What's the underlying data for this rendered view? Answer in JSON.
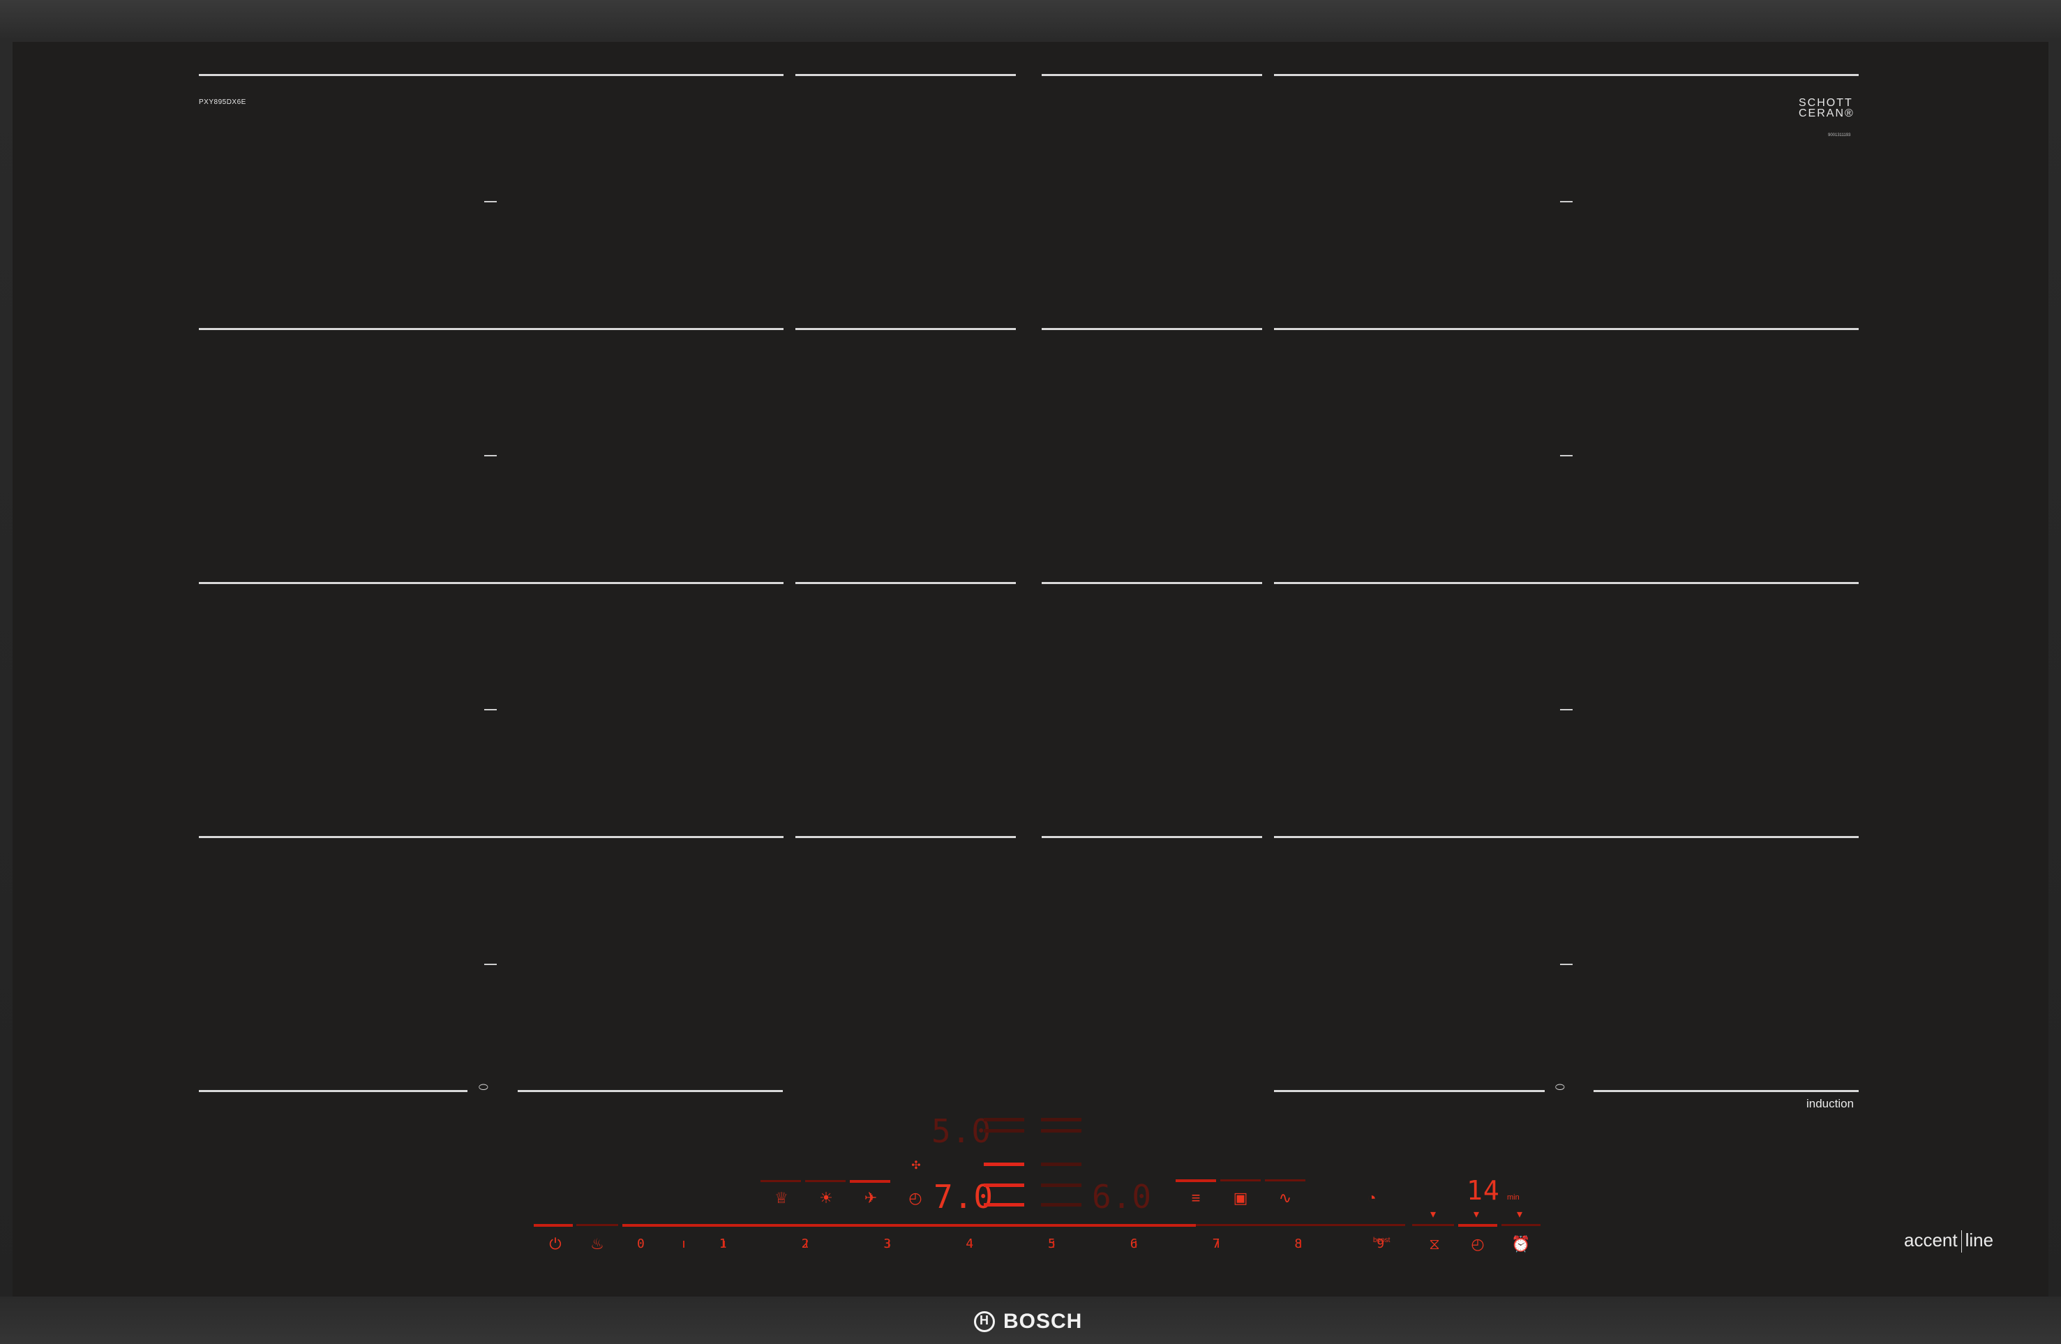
{
  "model": "PXY895DX6E",
  "brand_mark": {
    "line1": "SCHOTT",
    "line2": "CERAN®",
    "serial": "9001311193"
  },
  "induction_label": "induction",
  "series_label": {
    "left": "accent",
    "right": "line"
  },
  "brand_logo": "BOSCH",
  "zone_symbol": "⬭",
  "colors": {
    "glass": "#1f1e1d",
    "zone_lines": "#d9d9d9",
    "control_red": "#e02b1a"
  },
  "controls": {
    "power_icon": "power-icon",
    "child_lock_icon": "child-lock-icon",
    "slider_numbers": [
      "0",
      "1",
      "2",
      "3",
      "4",
      "5",
      "6",
      "7",
      "8",
      "9"
    ],
    "boost_label": "boost",
    "displays": {
      "top": "5.0",
      "middle": "7.0",
      "right": "6.0"
    },
    "timer_minutes": "14",
    "timer_unit": "min",
    "wifi_icon": "wifi-icon",
    "mode_icons_left": [
      "frying-sensor-icon",
      "light-icon",
      "fan-icon",
      "timer-icon"
    ],
    "mode_icons_right": [
      "recipe-icon",
      "pan-icon",
      "flex-zone-icon"
    ],
    "time_icons": [
      "egg-timer-icon",
      "stopwatch-icon",
      "alarm-icon"
    ],
    "symbols": {
      "power": "⏻",
      "child_lock": "♨",
      "wifi": "◔",
      "modes_left": [
        "♕",
        "☀",
        "✈",
        "◴"
      ],
      "modes_right": [
        "≡",
        "▣",
        "∿"
      ],
      "time": [
        "⧖",
        "◴",
        "⏰"
      ]
    }
  }
}
